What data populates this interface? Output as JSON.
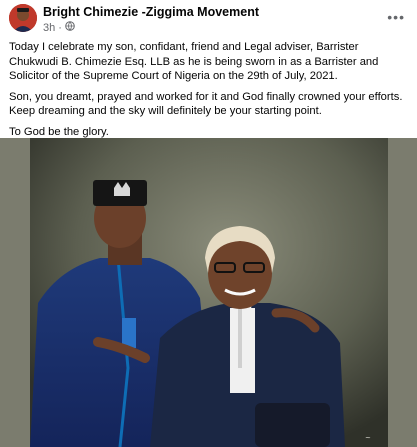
{
  "post": {
    "author": "Bright Chimezie -Ziggima Movement",
    "time": "3h",
    "privacy_icon": "globe-icon",
    "more_icon": "more-options-icon",
    "paragraphs": [
      "Today I celebrate my son, confidant, friend and Legal adviser, Barrister Chukwudi B. Chimezie Esq. LLB as he is being sworn in as a Barrister and Solicitor of the Supreme Court of Nigeria on the 29th of July, 2021.",
      "Son, you dreamt, prayed and worked for it and God finally crowned your efforts. Keep dreaming and the sky will definitely be your starting point.",
      "To God  be the glory."
    ]
  },
  "colors": {
    "text": "#050505",
    "secondary": "#65676b"
  }
}
